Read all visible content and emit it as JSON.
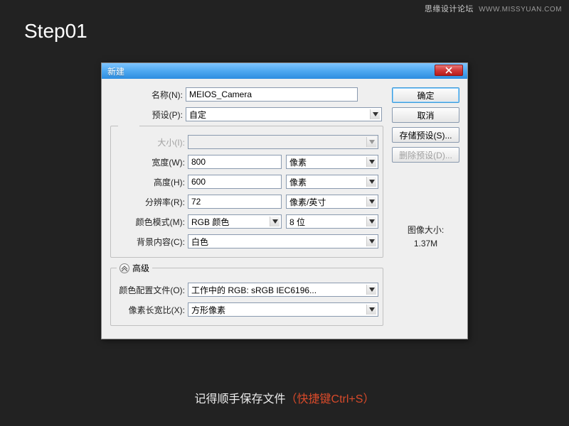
{
  "watermark": {
    "cn": "思缘设计论坛",
    "en": "WWW.MISSYUAN.COM"
  },
  "step": "Step01",
  "dialog": {
    "title": "新建",
    "rows": {
      "name": {
        "label": "名称(N):",
        "value": "MEIOS_Camera"
      },
      "preset": {
        "label": "预设(P):",
        "value": "自定"
      },
      "size": {
        "label": "大小(I):",
        "value": ""
      },
      "width": {
        "label": "宽度(W):",
        "value": "800",
        "unit": "像素"
      },
      "height": {
        "label": "高度(H):",
        "value": "600",
        "unit": "像素"
      },
      "resolution": {
        "label": "分辨率(R):",
        "value": "72",
        "unit": "像素/英寸"
      },
      "colormode": {
        "label": "颜色模式(M):",
        "value": "RGB 颜色",
        "depth": "8 位"
      },
      "bg": {
        "label": "背景内容(C):",
        "value": "白色"
      },
      "advanced": {
        "label": "高级"
      },
      "profile": {
        "label": "颜色配置文件(O):",
        "value": "工作中的 RGB: sRGB IEC6196..."
      },
      "aspect": {
        "label": "像素长宽比(X):",
        "value": "方形像素"
      }
    },
    "buttons": {
      "ok": "确定",
      "cancel": "取消",
      "save_preset": "存储预设(S)...",
      "delete_preset": "删除预设(D)..."
    },
    "image_size": {
      "label": "图像大小:",
      "value": "1.37M"
    }
  },
  "footer": {
    "white": "记得顺手保存文件",
    "red": "（快捷键Ctrl+S）"
  }
}
